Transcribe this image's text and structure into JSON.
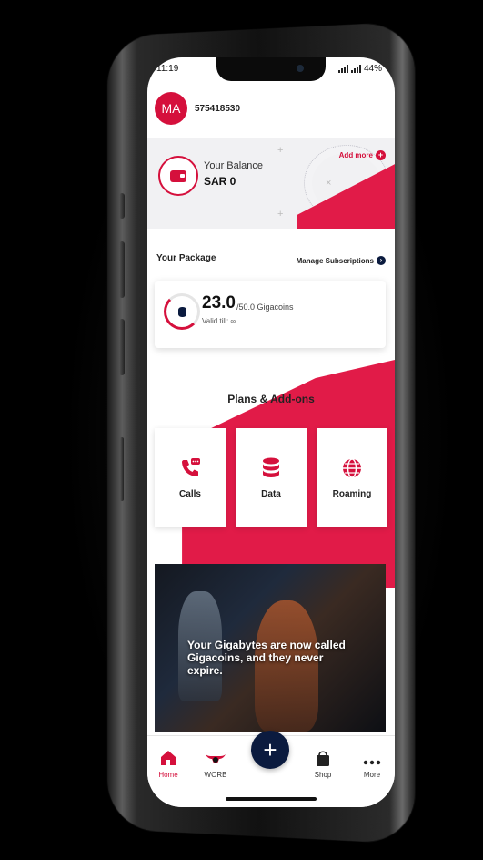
{
  "status_bar": {
    "time": "11:19",
    "battery": "44%"
  },
  "header": {
    "avatar_initials": "MA",
    "phone_number": "575418530"
  },
  "balance": {
    "label": "Your Balance",
    "value": "SAR 0",
    "add_more": "Add more"
  },
  "package": {
    "title": "Your Package",
    "manage_label": "Manage Subscriptions",
    "used": "23.0",
    "total": "/50.0 Gigacoins",
    "valid": "Valid till: ∞",
    "progress_fraction": 0.46
  },
  "plans": {
    "title": "Plans & Add-ons",
    "tiles": [
      {
        "label": "Calls",
        "icon": "phone-chat-icon"
      },
      {
        "label": "Data",
        "icon": "database-icon"
      },
      {
        "label": "Roaming",
        "icon": "globe-icon"
      }
    ]
  },
  "banner": {
    "text": "Your Gigabytes are now called Gigacoins, and they never expire."
  },
  "nav": {
    "items": [
      {
        "label": "Home",
        "icon": "home-icon"
      },
      {
        "label": "WORB",
        "icon": "bull-icon"
      },
      {
        "label": "",
        "icon": "plus-icon"
      },
      {
        "label": "Shop",
        "icon": "bag-icon"
      },
      {
        "label": "More",
        "icon": "dots-icon"
      }
    ]
  },
  "colors": {
    "brand": "#d5103c",
    "accent_red": "#e11b48",
    "navy": "#0b1b3f",
    "balance_bg": "#f1f1f3"
  }
}
